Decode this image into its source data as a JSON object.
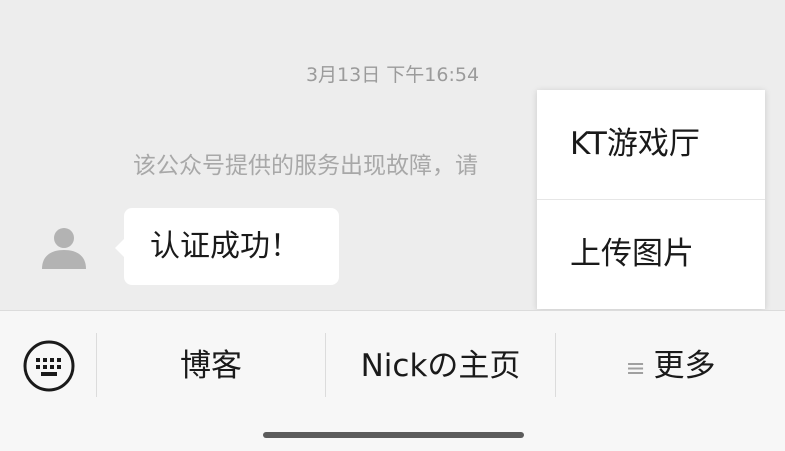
{
  "chat": {
    "timestamp": "3月13日 下午16:54",
    "system_notice": "该公众号提供的服务出现故障，请",
    "message": "认证成功！"
  },
  "popup_menu": {
    "items": [
      {
        "label": "KT游戏厅"
      },
      {
        "label": "上传图片"
      }
    ]
  },
  "bottom_bar": {
    "keyboard_icon": "keyboard-icon",
    "menu": [
      {
        "label": "博客"
      },
      {
        "label": "Nickの主页"
      },
      {
        "label": "更多",
        "icon": "≡"
      }
    ]
  },
  "colors": {
    "background": "#ededed",
    "bubble": "#ffffff",
    "muted_text": "#a8a8a8",
    "bar_background": "#f7f7f7"
  }
}
